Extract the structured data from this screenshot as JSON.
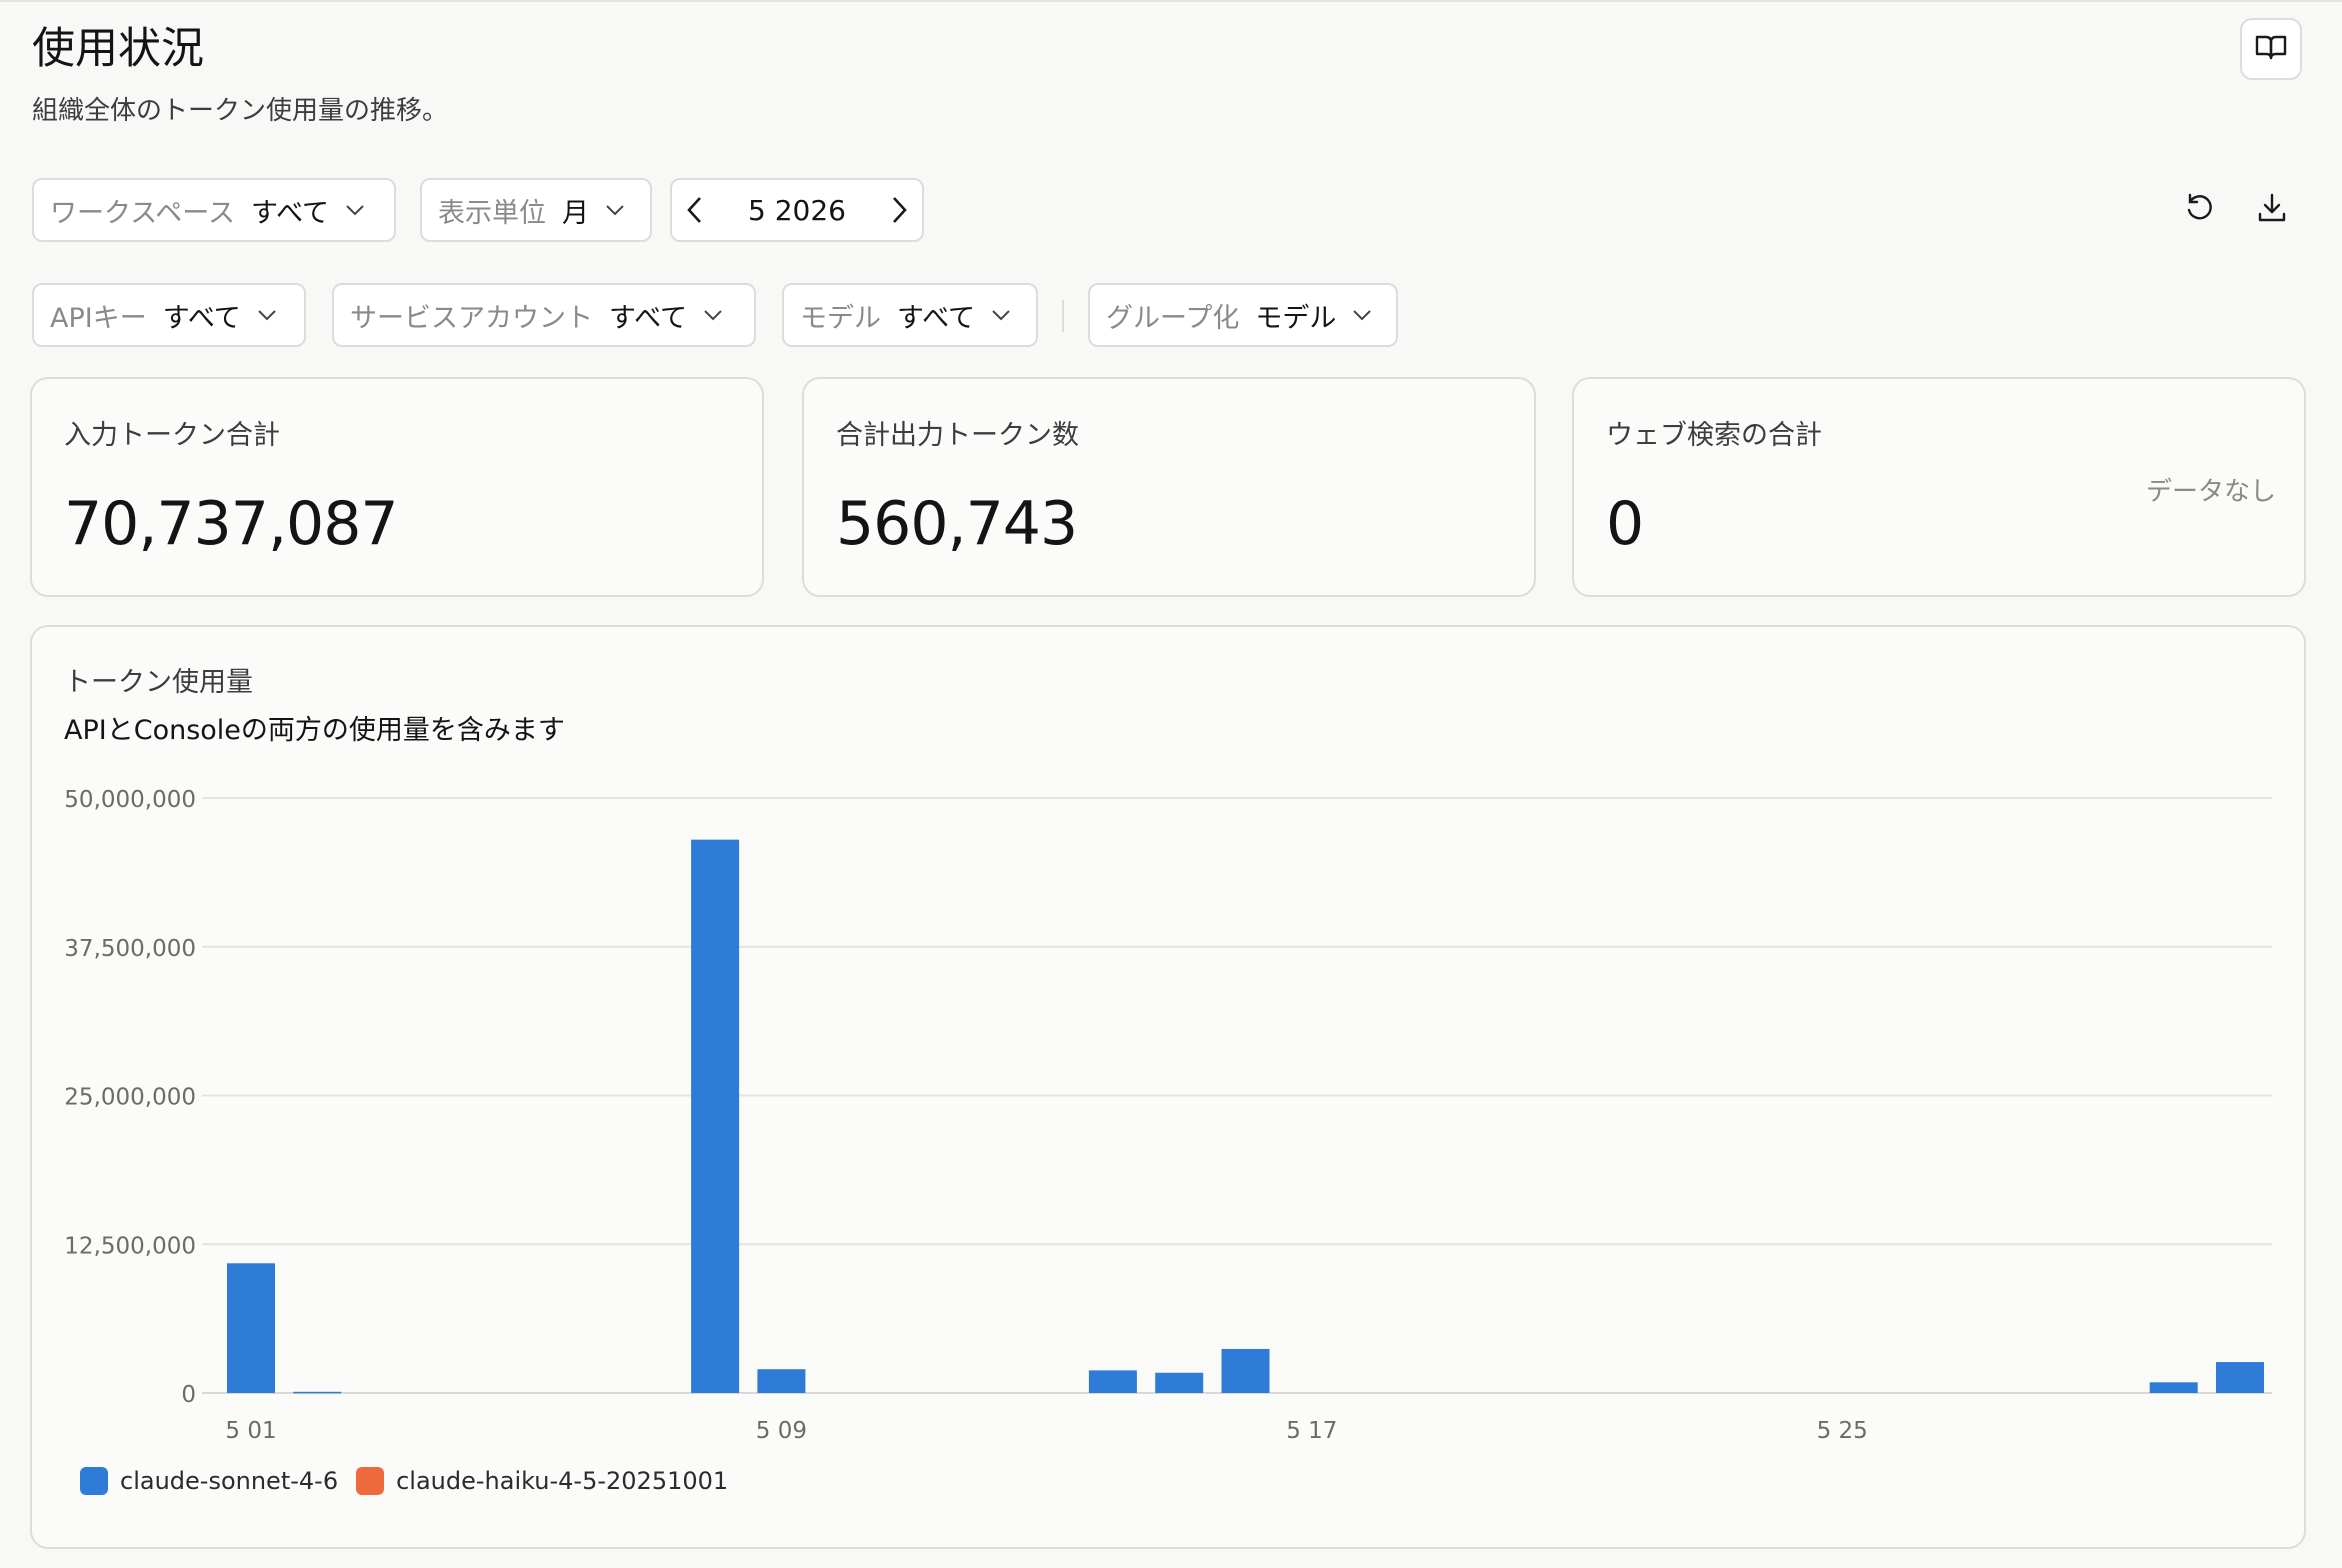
{
  "header": {
    "title": "使用状況",
    "subtitle": "組織全体のトークン使用量の推移。"
  },
  "filters": {
    "workspace": {
      "label": "ワークスペース",
      "value": "すべて"
    },
    "granularity": {
      "label": "表示単位",
      "value": "月"
    },
    "period": {
      "value": "5 2026"
    },
    "api_key": {
      "label": "APIキー",
      "value": "すべて"
    },
    "service_account": {
      "label": "サービスアカウント",
      "value": "すべて"
    },
    "model": {
      "label": "モデル",
      "value": "すべて"
    },
    "group_by": {
      "label": "グループ化",
      "value": "モデル"
    }
  },
  "icons": {
    "docs": "book-open-icon",
    "reset": "rotate-ccw-icon",
    "download": "download-icon",
    "prev": "chevron-left-icon",
    "next": "chevron-right-icon",
    "dropdown": "chevron-down-icon"
  },
  "cards": [
    {
      "label": "入力トークン合計",
      "value": "70,737,087",
      "note": ""
    },
    {
      "label": "合計出力トークン数",
      "value": "560,743",
      "note": ""
    },
    {
      "label": "ウェブ検索の合計",
      "value": "0",
      "note": "データなし"
    }
  ],
  "chart": {
    "title": "トークン使用量",
    "subtitle": "APIとConsoleの両方の使用量を含みます"
  },
  "legend": [
    {
      "name": "claude-sonnet-4-6",
      "color": "#2f7bd8"
    },
    {
      "name": "claude-haiku-4-5-20251001",
      "color": "#ec6a3b"
    }
  ],
  "chart_data": {
    "type": "bar",
    "categories": [
      "5 01",
      "5 02",
      "5 03",
      "5 04",
      "5 05",
      "5 06",
      "5 07",
      "5 08",
      "5 09",
      "5 10",
      "5 11",
      "5 12",
      "5 13",
      "5 14",
      "5 15",
      "5 16",
      "5 17",
      "5 18",
      "5 19",
      "5 20",
      "5 21",
      "5 22",
      "5 23",
      "5 24",
      "5 25",
      "5 26",
      "5 27",
      "5 28",
      "5 29",
      "5 30",
      "5 31"
    ],
    "tick_labels": [
      "5 01",
      "5 09",
      "5 17",
      "5 25"
    ],
    "y_ticks": [
      "0",
      "12,500,000",
      "25,000,000",
      "37,500,000",
      "50,000,000"
    ],
    "ylim": [
      0,
      50000000
    ],
    "series": [
      {
        "name": "claude-sonnet-4-6",
        "values": [
          10900000,
          100000,
          0,
          0,
          0,
          0,
          0,
          46500000,
          2000000,
          0,
          0,
          0,
          0,
          1900000,
          1700000,
          3700000,
          0,
          0,
          0,
          0,
          0,
          0,
          0,
          0,
          0,
          0,
          0,
          0,
          0,
          900000,
          2600000
        ]
      },
      {
        "name": "claude-haiku-4-5-20251001",
        "values": [
          0,
          0,
          0,
          0,
          0,
          0,
          0,
          0,
          0,
          0,
          0,
          0,
          0,
          0,
          0,
          0,
          0,
          0,
          0,
          0,
          0,
          0,
          0,
          0,
          0,
          0,
          0,
          0,
          0,
          0,
          0
        ]
      }
    ],
    "grid": true,
    "legend_position": "bottom-left"
  }
}
